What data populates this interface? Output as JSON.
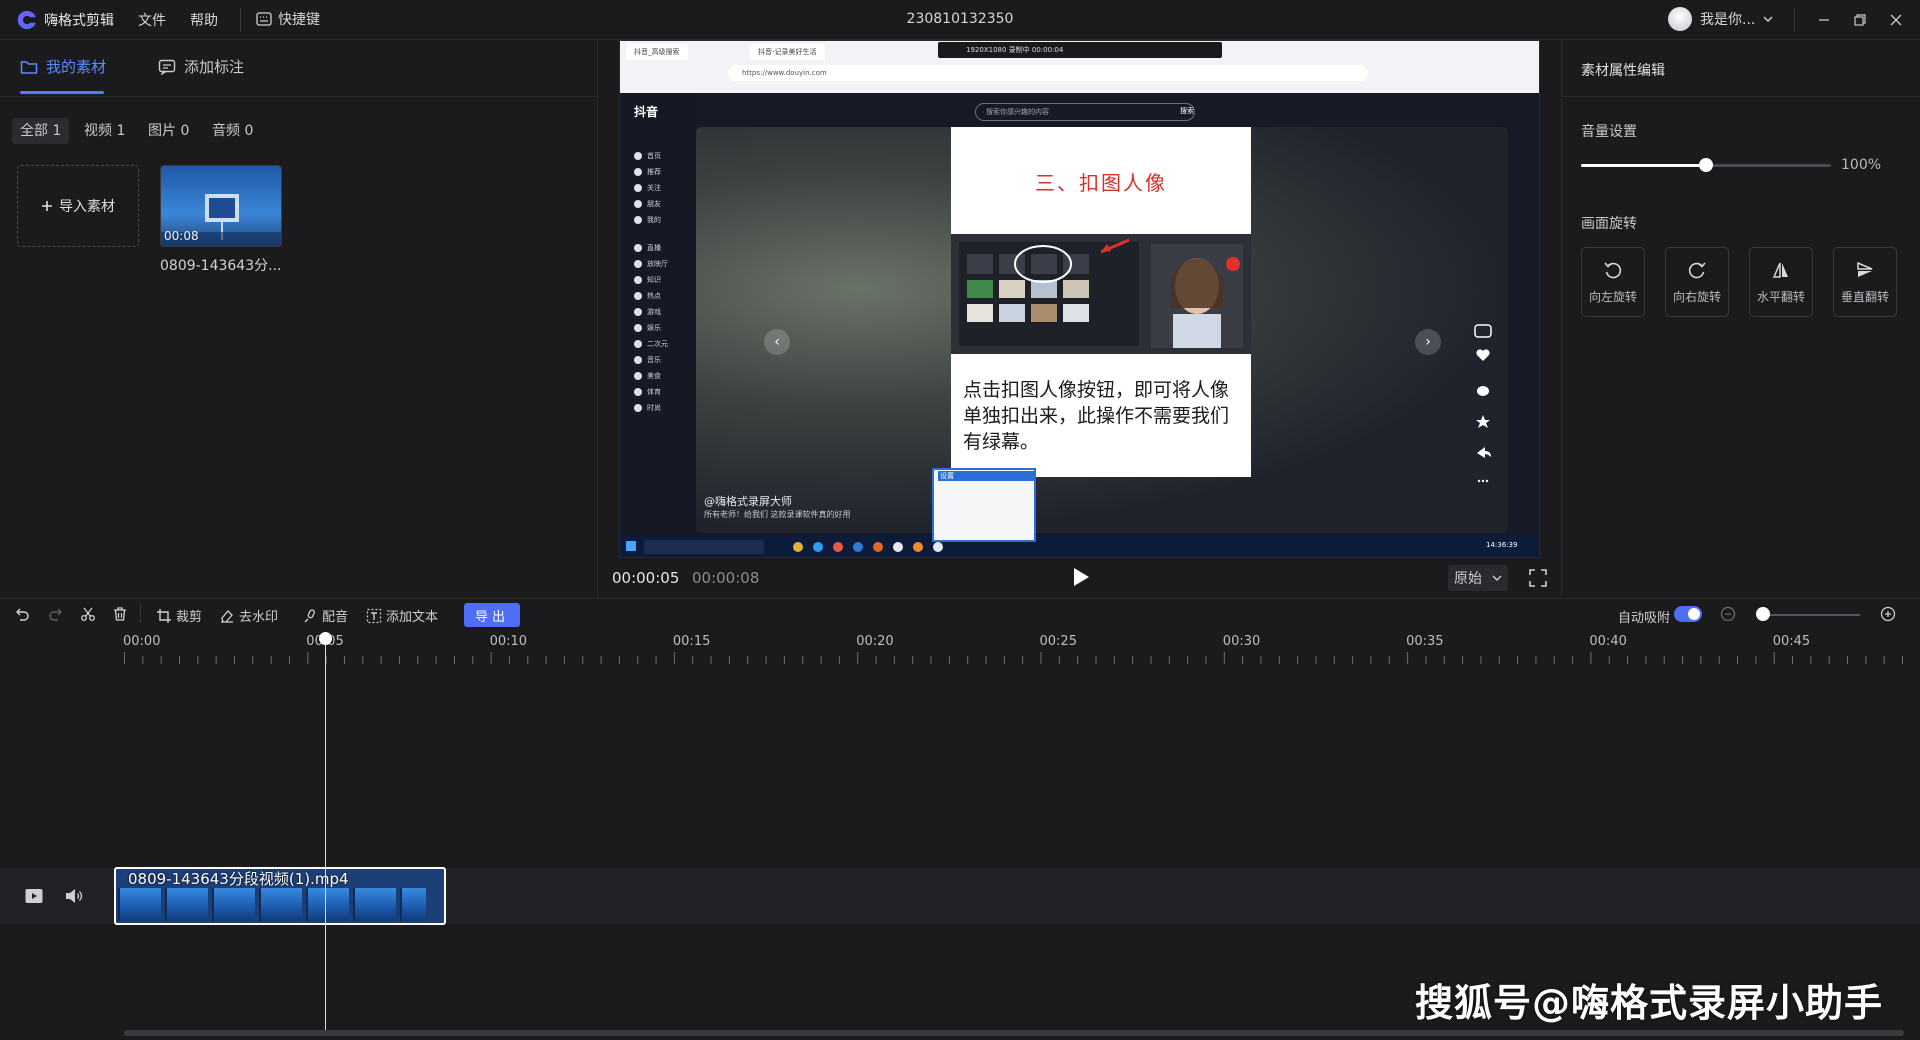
{
  "app": {
    "name": "嗨格式剪辑",
    "menus": [
      "文件",
      "帮助"
    ],
    "shortcut_label": "快捷键",
    "window_title": "230810132350",
    "user_label": "我是你...",
    "colors": {
      "accent": "#4f6ef7",
      "bg": "#1b1b1d",
      "text": "#cfcfd3"
    }
  },
  "left_panel": {
    "tabs": [
      {
        "label": "我的素材",
        "icon": "folder-icon",
        "active": true
      },
      {
        "label": "添加标注",
        "icon": "annotation-icon",
        "active": false
      }
    ],
    "filters": [
      "全部 1",
      "视频 1",
      "图片 0",
      "音频 0"
    ],
    "import_label": "导入素材",
    "asset": {
      "duration": "00:08",
      "name": "0809-143643分..."
    }
  },
  "preview": {
    "current_time": "00:00:05",
    "total_time": "00:00:08",
    "ratio_label": "原始",
    "frame": {
      "tabs": [
        "抖音_高级搜索",
        "抖音-记录美好生活"
      ],
      "url": "https://www.douyin.com",
      "rec_bar": "1920X1080    录制中 00:00:04",
      "site_logo": "抖音",
      "sidebar": [
        "首页",
        "推荐",
        "关注",
        "朋友",
        "我的",
        "直播",
        "放映厅",
        "知识",
        "热点",
        "游戏",
        "娱乐",
        "二次元",
        "音乐",
        "美食",
        "体育",
        "时尚"
      ],
      "search_placeholder": "搜索你感兴趣的内容",
      "search_button": "搜索",
      "slide_title": "三、扣图人像",
      "slide_text": "点击扣图人像按钮，即可将人像单独扣出来，此操作不需要我们有绿幕。",
      "author": "@嗨格式录屏大师",
      "caption": "所有老师！给我们 这款录课软件真的好用",
      "popup_title": "设置",
      "clock": "14:36:39"
    }
  },
  "properties": {
    "title": "素材属性编辑",
    "volume_label": "音量设置",
    "volume_value": "100%",
    "volume_fraction": 0.5,
    "rotate_label": "画面旋转",
    "rotate_buttons": [
      {
        "label": "向左旋转",
        "icon": "rotate-left-icon"
      },
      {
        "label": "向右旋转",
        "icon": "rotate-right-icon"
      },
      {
        "label": "水平翻转",
        "icon": "flip-horizontal-icon"
      },
      {
        "label": "垂直翻转",
        "icon": "flip-vertical-icon"
      }
    ]
  },
  "toolbar": {
    "crop": "裁剪",
    "remove_watermark": "去水印",
    "dub": "配音",
    "add_text": "添加文本",
    "export": "导出",
    "auto_snap": "自动吸附",
    "auto_snap_on": true
  },
  "timeline": {
    "ticks": [
      "00:00",
      "00:05",
      "00:10",
      "00:15",
      "00:20",
      "00:25",
      "00:30",
      "00:35",
      "00:40",
      "00:45"
    ],
    "clip_name": "0809-143643分段视频(1).mp4"
  },
  "watermark": "搜狐号@嗨格式录屏小助手"
}
